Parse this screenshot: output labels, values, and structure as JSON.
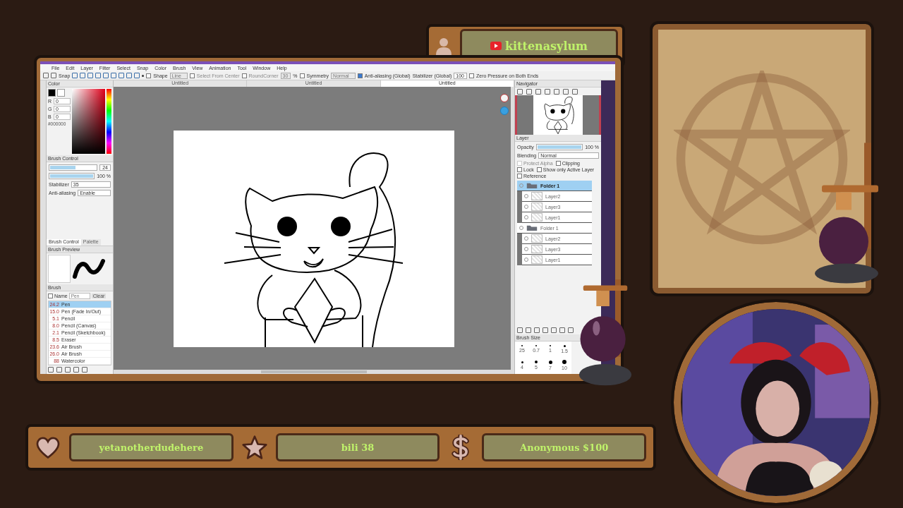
{
  "channel": {
    "name": "kittenasylum"
  },
  "app": {
    "menu": [
      "File",
      "Edit",
      "Layer",
      "Filter",
      "Select",
      "Snap",
      "Color",
      "Brush",
      "View",
      "Animation",
      "Tool",
      "Window",
      "Help"
    ],
    "toolbar": {
      "snap_label": "Snap",
      "shape": {
        "label": "Shape",
        "checked": false,
        "value": "Line"
      },
      "select_from_center": {
        "label": "Select From Center",
        "checked": false
      },
      "round_corner": {
        "label": "RoundCorner",
        "checked": false,
        "value": "30"
      },
      "percent": "%",
      "symmetry": {
        "label": "Symmetry",
        "checked": false,
        "value": "Normal"
      },
      "anti_aliasing": {
        "label": "Anti-aliasing (Global)",
        "checked": true
      },
      "stabilizer": {
        "label": "Stabilizer (Global)",
        "value": "100"
      },
      "zero_pressure": {
        "label": "Zero Pressure on Both Ends",
        "checked": false
      }
    },
    "tabs": [
      {
        "label": "Untitled",
        "selected": false
      },
      {
        "label": "Untitled",
        "selected": false
      },
      {
        "label": "Untitled",
        "selected": true
      }
    ],
    "color_panel": {
      "title": "Color",
      "fields": [
        {
          "label": "R",
          "value": "0"
        },
        {
          "label": "G",
          "value": "0"
        },
        {
          "label": "B",
          "value": "0"
        }
      ],
      "hex": "#000000"
    },
    "brush_control": {
      "title": "Brush Control",
      "size": {
        "level": 0.55,
        "value": "24"
      },
      "opacity": {
        "level": 1,
        "value": "100 %"
      },
      "stabilizer_label": "Stabilizer",
      "stabilizer": "35",
      "anti_alias_label": "Anti-aliasing",
      "anti_alias": "Enable"
    },
    "panel_tabs": [
      {
        "label": "Brush Control",
        "selected": true
      },
      {
        "label": "Palette",
        "selected": false
      }
    ],
    "brush_preview": {
      "title": "Brush Preview"
    },
    "brush_list": {
      "title": "Brush",
      "name_filter": {
        "label": "Name",
        "checked": false
      },
      "name_placeholder": "Pen",
      "clear": "Clear",
      "items": [
        {
          "size": "24.2",
          "name": "Pen",
          "selected": true
        },
        {
          "size": "15.0",
          "name": "Pen (Fade In/Out)",
          "selected": false
        },
        {
          "size": "5.1",
          "name": "Pencil",
          "selected": false
        },
        {
          "size": "8.0",
          "name": "Pencil (Canvas)",
          "selected": false
        },
        {
          "size": "2.1",
          "name": "Pencil (Sketchbook)",
          "selected": false
        },
        {
          "size": "8.5",
          "name": "Eraser",
          "selected": false
        },
        {
          "size": "23.6",
          "name": "Air Brush",
          "selected": false
        },
        {
          "size": "26.0",
          "name": "Air Brush",
          "selected": false
        },
        {
          "size": "88",
          "name": "Watercolor",
          "selected": false
        }
      ]
    },
    "navigator": {
      "title": "Navigator"
    },
    "layer_panel": {
      "title": "Layer",
      "opacity_label": "Opacity",
      "opacity": {
        "level": 1,
        "value": "100 %"
      },
      "blending_label": "Blending",
      "blending": "Normal",
      "options": [
        {
          "label": "Protect Alpha",
          "checked": false,
          "disabled": true
        },
        {
          "label": "Clipping",
          "checked": false,
          "disabled": false
        },
        {
          "label": "Lock",
          "checked": false,
          "disabled": false
        },
        {
          "label": "Show only Active Layer",
          "checked": false,
          "disabled": false
        },
        {
          "label": "Reference",
          "checked": false,
          "disabled": false
        }
      ],
      "layers": [
        {
          "name": "Folder 1",
          "kind": "folder",
          "selected": true,
          "children": [
            {
              "name": "Layer2",
              "kind": "layer",
              "selected": false
            },
            {
              "name": "Layer3",
              "kind": "layer",
              "selected": false
            },
            {
              "name": "Layer1",
              "kind": "layer",
              "selected": false
            }
          ]
        },
        {
          "name": "Folder 1",
          "kind": "folder",
          "selected": false,
          "children": [
            {
              "name": "Layer2",
              "kind": "layer",
              "selected": false
            },
            {
              "name": "Layer3",
              "kind": "layer",
              "selected": false
            },
            {
              "name": "Layer1",
              "kind": "layer",
              "selected": false
            }
          ]
        }
      ]
    },
    "brush_size": {
      "title": "Brush Size",
      "sizes": [
        "25",
        "0.7",
        "1",
        "1.5",
        "4",
        "5",
        "7",
        "10"
      ]
    }
  },
  "alerts": [
    {
      "kind": "heart",
      "text": "yetanotherdudehere"
    },
    {
      "kind": "star",
      "text": "bili 38"
    },
    {
      "kind": "dollar",
      "text": "Anonymous $100"
    }
  ]
}
